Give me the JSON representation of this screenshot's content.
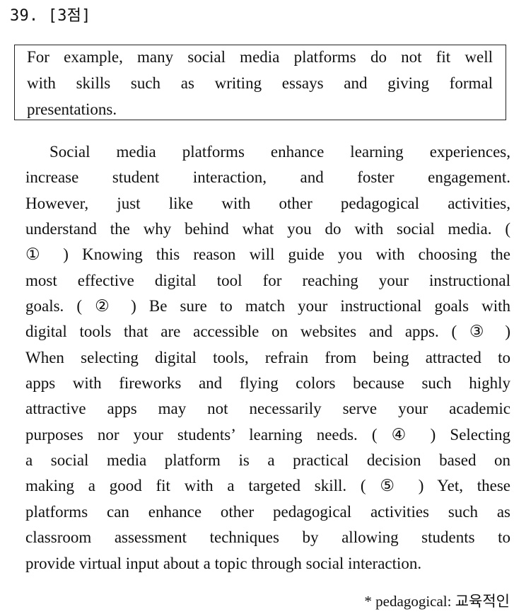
{
  "question": {
    "number_label": "39. [3점]"
  },
  "given_sentence": {
    "lines": [
      "For example, many social media platforms do not fit well",
      "with skills such as writing essays and giving formal",
      "presentations."
    ]
  },
  "passage": {
    "lines": [
      "Social media platforms enhance learning experiences,",
      "increase student interaction, and foster engagement.",
      "However, just like with other pedagogical activities,",
      "understand the why behind what you do with social media. (",
      "① ) Knowing this reason will guide you with choosing the",
      "most effective digital tool for reaching your instructional",
      "goals. ( ② ) Be sure to match your instructional goals with",
      "digital tools that are accessible on websites and apps. ( ③ )",
      "When selecting digital tools, refrain from being attracted to",
      "apps with fireworks and flying colors because such highly",
      "attractive apps may not necessarily serve your academic",
      "purposes nor your students’ learning needs. ( ④ ) Selecting",
      "a social media platform is a practical decision based on",
      "making a good fit with a targeted skill. ( ⑤ ) Yet, these",
      "platforms can enhance other pedagogical activities such as",
      "classroom assessment techniques by allowing students to",
      "provide virtual input about a topic through social interaction."
    ]
  },
  "footnote": {
    "text": "* pedagogical: 교육적인"
  }
}
